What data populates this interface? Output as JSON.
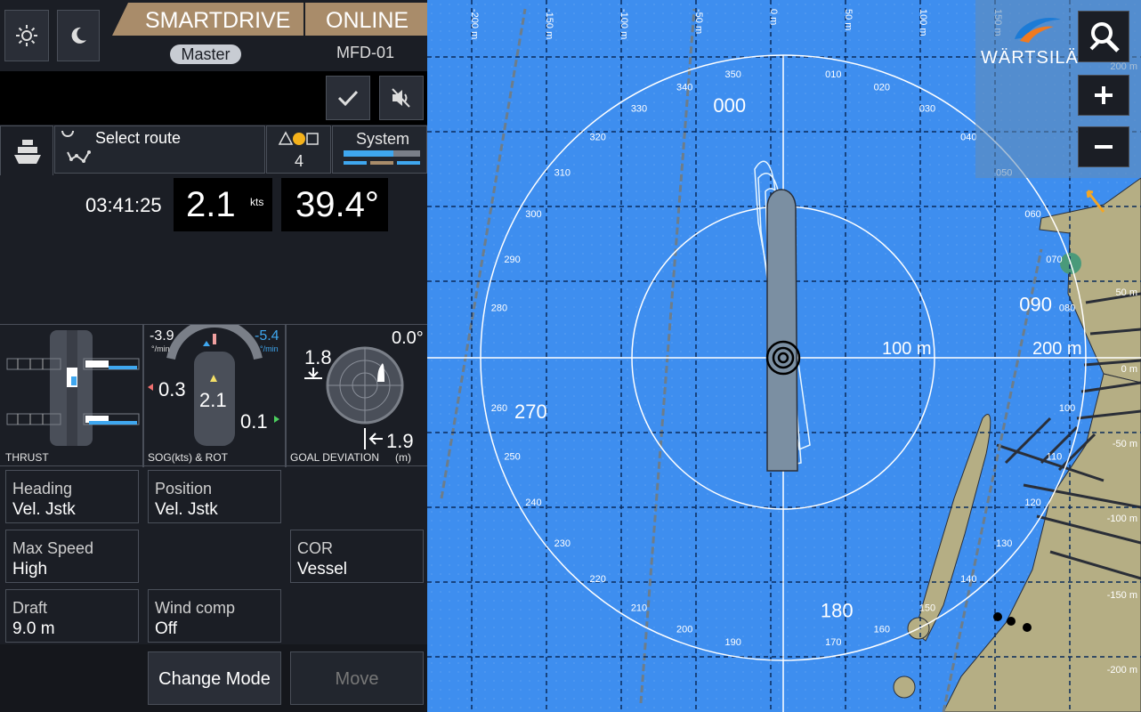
{
  "header": {
    "brand": "SMARTDRIVE",
    "status": "ONLINE",
    "role": "Master",
    "station": "MFD-01"
  },
  "tabs": {
    "route": "Select route",
    "shapes_count": "4",
    "system": "System"
  },
  "readouts": {
    "time": "03:41:25",
    "speed": "2.1",
    "speed_unit": "kts",
    "heading": "39.4°"
  },
  "gauges": {
    "thrust_label": "THRUST",
    "sog_left": "-3.9",
    "sog_right": "-5.4",
    "rot_unit": "°/min",
    "lateral_left": "0.3",
    "sog_value": "2.1",
    "lateral_right": "0.1",
    "sog_label": "SOG(kts) & ROT",
    "goal_depth": "1.8",
    "goal_angle": "0.0°",
    "goal_lateral": "1.9",
    "goal_label": "GOAL DEVIATION",
    "goal_unit": "(m)"
  },
  "modes": [
    {
      "name": "Heading",
      "value": "Vel. Jstk"
    },
    {
      "name": "Position",
      "value": "Vel. Jstk"
    },
    {
      "name": "Max Speed",
      "value": "High"
    },
    {
      "name": "COR",
      "value": "Vessel"
    },
    {
      "name": "Draft",
      "value": "9.0 m"
    },
    {
      "name": "Wind comp",
      "value": "Off"
    }
  ],
  "actions": {
    "change_mode": "Change Mode",
    "move": "Move"
  },
  "map": {
    "logo": "WÄRTSILÄ",
    "top_ticks": [
      "-200 m",
      "-150 m",
      "-100 m",
      "-50 m",
      "0 m",
      "50 m",
      "100 m",
      "150 m"
    ],
    "right_ticks": [
      "200 m",
      "50 m",
      "0 m",
      "-50 m",
      "-100 m",
      "-150 m",
      "-200 m"
    ],
    "ring_small": "100 m",
    "ring_big": "200 m",
    "cardinals": [
      "000",
      "090",
      "180",
      "270"
    ],
    "bearings": [
      "010",
      "020",
      "030",
      "040",
      "050",
      "060",
      "070",
      "080",
      "100",
      "110",
      "120",
      "130",
      "140",
      "150",
      "160",
      "170",
      "190",
      "200",
      "210",
      "220",
      "230",
      "240",
      "250",
      "260",
      "280",
      "290",
      "300",
      "310",
      "320",
      "330",
      "340",
      "350"
    ]
  },
  "colors": {
    "sea": "#3e8eef",
    "land": "#b5ae84",
    "accent": "#a98c6a",
    "panel": "#1b1e25"
  }
}
